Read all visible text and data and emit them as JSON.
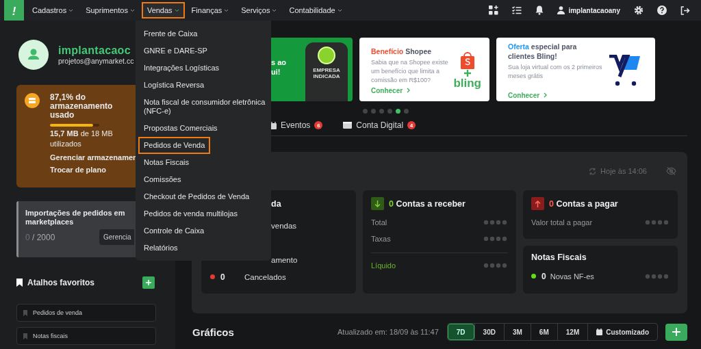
{
  "topbar": {
    "logo": "!",
    "nav": [
      {
        "label": "Cadastros",
        "selected": false
      },
      {
        "label": "Suprimentos",
        "selected": false
      },
      {
        "label": "Vendas",
        "selected": true
      },
      {
        "label": "Finanças",
        "selected": false
      },
      {
        "label": "Serviços",
        "selected": false
      },
      {
        "label": "Contabilidade",
        "selected": false
      }
    ],
    "user": "implantacaoany"
  },
  "menu": [
    {
      "label": "Frente de Caixa",
      "selected": false
    },
    {
      "label": "GNRE e DARE-SP",
      "selected": false
    },
    {
      "label": "Integrações Logísticas",
      "selected": false
    },
    {
      "label": "Logística Reversa",
      "selected": false
    },
    {
      "label": "Nota fiscal de consumidor eletrônica (NFC-e)",
      "selected": false
    },
    {
      "label": "Propostas Comerciais",
      "selected": false
    },
    {
      "label": "Pedidos de Venda",
      "selected": true
    },
    {
      "label": "Notas Fiscais",
      "selected": false
    },
    {
      "label": "Comissões",
      "selected": false
    },
    {
      "label": "Checkout de Pedidos de Venda",
      "selected": false
    },
    {
      "label": "Pedidos de venda multilojas",
      "selected": false
    },
    {
      "label": "Controle de Caixa",
      "selected": false
    },
    {
      "label": "Relatórios",
      "selected": false
    }
  ],
  "profile": {
    "name": "implantacaoc",
    "email": "projetos@anymarket.cc"
  },
  "storage": {
    "title": "87,1% do armazenamento usado",
    "level": 0.871,
    "used": "15,7 MB",
    "total": "de 18 MB utilizados",
    "links": [
      "Gerenciar armazenamer",
      "Trocar de plano"
    ]
  },
  "imports": {
    "title": "Importações de pedidos em marketplaces",
    "count": "0",
    "limit": "/ 2000",
    "button": "Gerencia"
  },
  "favorites": {
    "title": "Atalhos favoritos",
    "items": [
      "Pedidos de venda",
      "Notas fiscais"
    ]
  },
  "banners": [
    {
      "kind": "partner",
      "lines": [
        "s ao",
        "ui!"
      ],
      "badge": "EMPRESA INDICADA"
    },
    {
      "kind": "shopee",
      "title": [
        "Benefício",
        "Shopee"
      ],
      "color": "#ee4d2d",
      "text": "Sabia que na Shopee existe um benefício que limita a comissão em R$100?",
      "link": "Conhecer",
      "logo": "bling"
    },
    {
      "kind": "store",
      "title": [
        "Oferta",
        "especial para clientes Bling!"
      ],
      "color": "#2196f3",
      "text": "Sua loja virtual com os 2 primeiros meses grátis",
      "link": "Conhecer"
    }
  ],
  "carousel_dots": [
    {
      "selected": false
    },
    {
      "selected": false
    },
    {
      "selected": false
    },
    {
      "selected": false
    },
    {
      "selected": true
    },
    {
      "selected": false
    }
  ],
  "tabs": [
    {
      "label": "Eventos",
      "badge": "6",
      "kind": "calendar"
    },
    {
      "label": "Conta Digital",
      "badge": "4",
      "kind": "wallet"
    }
  ],
  "dashboard": {
    "updated": "Hoje às 14:06",
    "sales": {
      "title": "da",
      "rows": [
        {
          "label": "vendas"
        },
        {
          "label": "amento"
        },
        {
          "count": "0",
          "label": "Cancelados",
          "color": "#e53935"
        }
      ]
    },
    "receivable": {
      "count": "0",
      "title": "Contas a receber",
      "rows": [
        {
          "label": "Total",
          "kind": "plain"
        },
        {
          "label": "Taxas",
          "kind": "plain"
        },
        {
          "label": "Líquido",
          "kind": "total"
        }
      ]
    },
    "payable": {
      "count": "0",
      "title": "Contas a pagar",
      "rows": [
        {
          "label": "Valor total a pagar"
        }
      ]
    },
    "invoices": {
      "title": "Notas Fiscais",
      "count": "0",
      "label": "Novas NF-es",
      "color": "#64dd17"
    }
  },
  "charts": {
    "title": "Gráficos",
    "updated": "Atualizado em: 18/09 às 11:47",
    "ranges": [
      {
        "label": "7D",
        "selected": true
      },
      {
        "label": "30D",
        "selected": false
      },
      {
        "label": "3M",
        "selected": false
      },
      {
        "label": "6M",
        "selected": false
      },
      {
        "label": "12M",
        "selected": false
      },
      {
        "label": "Customizado",
        "selected": false
      }
    ]
  }
}
